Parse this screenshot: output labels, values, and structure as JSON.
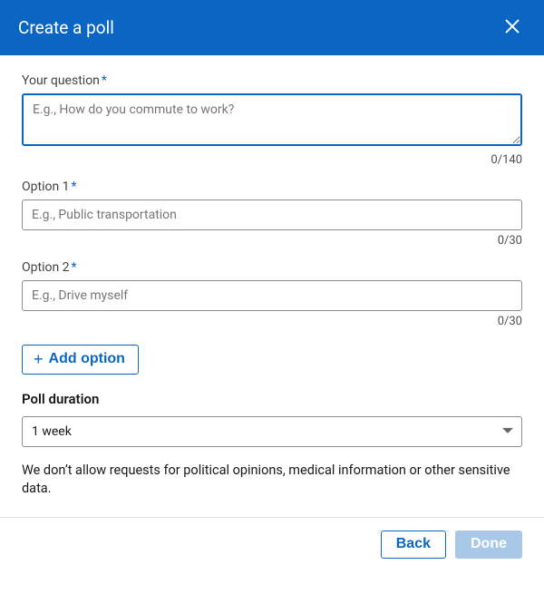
{
  "header": {
    "title": "Create a poll"
  },
  "question": {
    "label": "Your question",
    "placeholder": "E.g., How do you commute to work?",
    "value": "",
    "counter": "0/140"
  },
  "options": [
    {
      "label": "Option 1",
      "placeholder": "E.g., Public transportation",
      "value": "",
      "counter": "0/30"
    },
    {
      "label": "Option 2",
      "placeholder": "E.g., Drive myself",
      "value": "",
      "counter": "0/30"
    }
  ],
  "add_option_label": "Add option",
  "duration": {
    "label": "Poll duration",
    "selected": "1 week"
  },
  "disclaimer": "We don’t allow requests for political opinions, medical information or other sensitive data.",
  "footer": {
    "back": "Back",
    "done": "Done"
  }
}
